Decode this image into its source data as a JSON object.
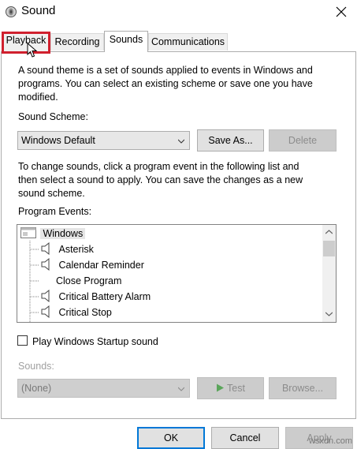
{
  "window": {
    "title": "Sound",
    "close_glyph": "✕",
    "icon": "speaker-icon"
  },
  "tabs": [
    {
      "label": "Playback"
    },
    {
      "label": "Recording"
    },
    {
      "label": "Sounds"
    },
    {
      "label": "Communications"
    }
  ],
  "description": {
    "line1": "A sound theme is a set of sounds applied to events in Windows and",
    "line2": "programs.  You can select an existing scheme or save one you have",
    "line3": "modified."
  },
  "scheme": {
    "label": "Sound Scheme:",
    "value": "Windows Default",
    "save_as": "Save As...",
    "delete": "Delete"
  },
  "instructions": {
    "line1": "To change sounds, click a program event in the following list and",
    "line2": "then select a sound to apply.  You can save the changes as a new",
    "line3": "sound scheme."
  },
  "events": {
    "label": "Program Events:",
    "group": "Windows",
    "items": [
      {
        "label": "Asterisk",
        "has_sound": true
      },
      {
        "label": "Calendar Reminder",
        "has_sound": true
      },
      {
        "label": "Close Program",
        "has_sound": false
      },
      {
        "label": "Critical Battery Alarm",
        "has_sound": true
      },
      {
        "label": "Critical Stop",
        "has_sound": true
      }
    ]
  },
  "startup": {
    "label": "Play Windows Startup sound",
    "checked": false
  },
  "sounds": {
    "label": "Sounds:",
    "value": "(None)",
    "test": "Test",
    "browse": "Browse..."
  },
  "footer": {
    "ok": "OK",
    "cancel": "Cancel",
    "apply": "Apply"
  },
  "watermark": "wsxdn.com",
  "colors": {
    "highlight": "#d0202e",
    "accent": "#0078d7"
  }
}
